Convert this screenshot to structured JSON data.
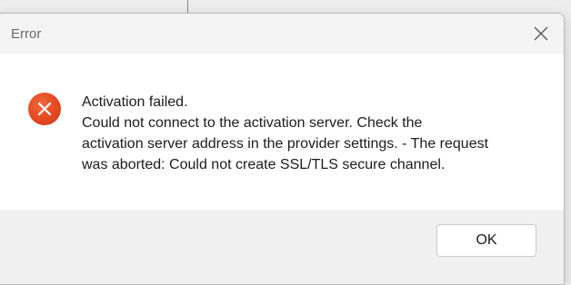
{
  "dialog": {
    "title": "Error",
    "close_icon": "close-icon",
    "error_icon": "error-x-icon",
    "message_lines": [
      "Activation failed.",
      "Could not connect to the activation server. Check the",
      "activation server address in the provider settings. - The request",
      "was aborted: Could not create SSL/TLS secure channel."
    ],
    "ok_label": "OK"
  },
  "colors": {
    "error_icon": "#e2461f",
    "content_bg": "#ffffff",
    "footer_bg": "#f0f0f0"
  }
}
